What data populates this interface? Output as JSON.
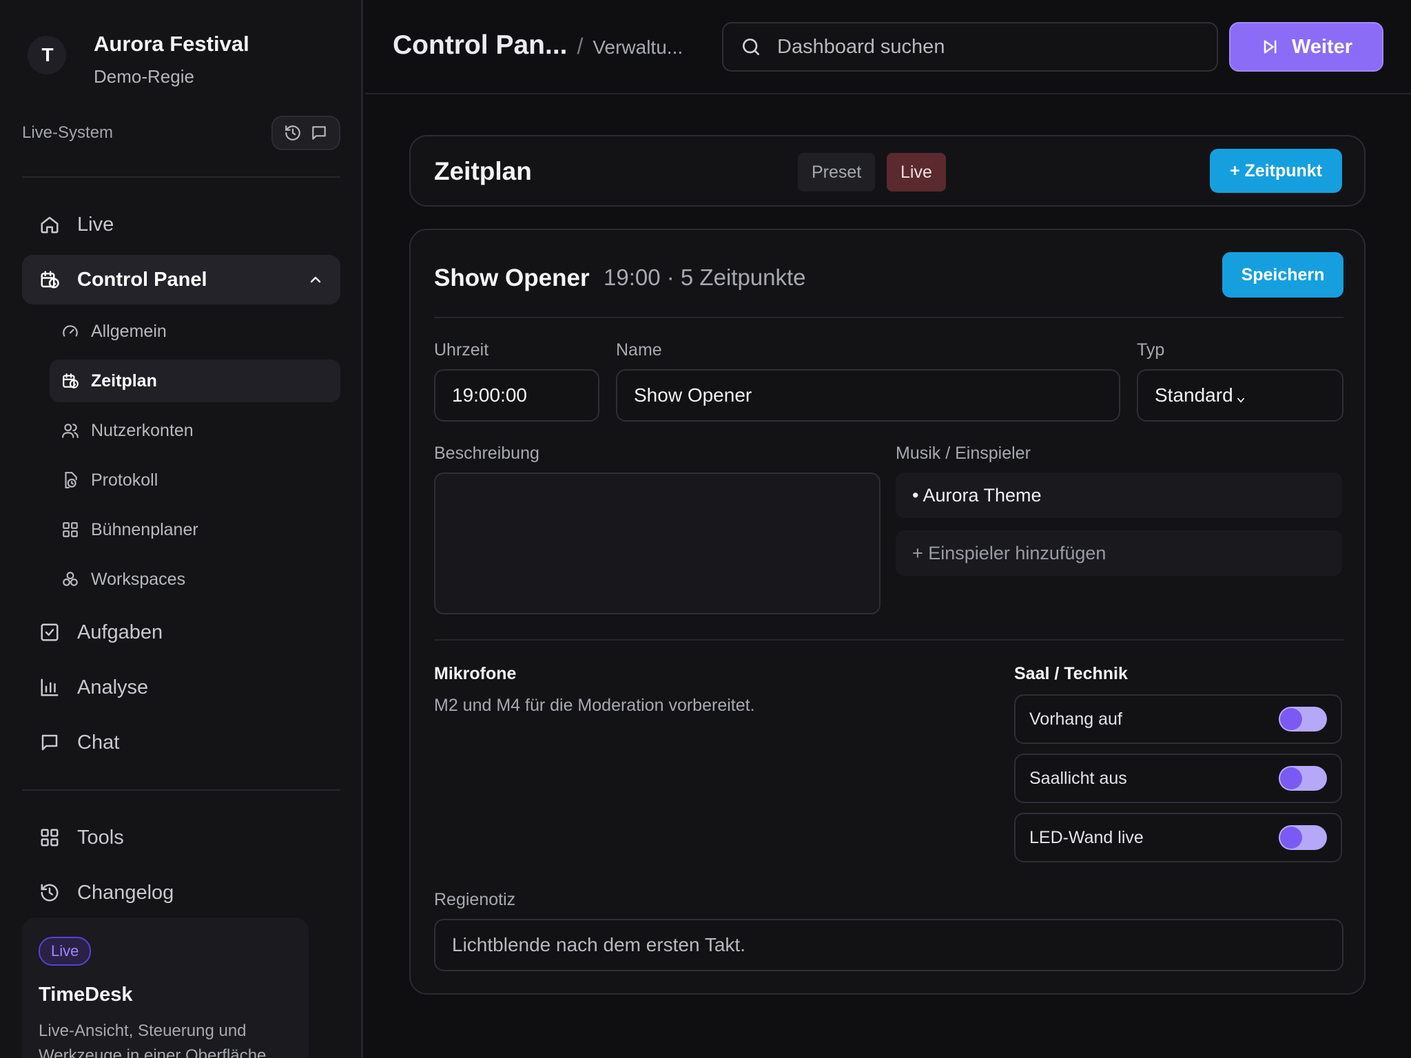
{
  "sidebar": {
    "brand": {
      "logo_text": "T",
      "title": "Aurora Festival",
      "subtitle": "Demo-Regie"
    },
    "system_label": "Live-System",
    "nav": [
      {
        "label": "Live",
        "icon": "home-icon"
      },
      {
        "label": "Control Panel",
        "icon": "calendar-clock-icon",
        "expanded": true
      }
    ],
    "subnav": [
      {
        "label": "Allgemein",
        "icon": "gauge-icon"
      },
      {
        "label": "Zeitplan",
        "icon": "calendar-clock-icon",
        "active": true
      },
      {
        "label": "Nutzerkonten",
        "icon": "users-icon"
      },
      {
        "label": "Protokoll",
        "icon": "file-clock-icon"
      },
      {
        "label": "Bühnenplaner",
        "icon": "grid-icon"
      },
      {
        "label": "Workspaces",
        "icon": "blocks-icon"
      }
    ],
    "nav2": [
      {
        "label": "Aufgaben",
        "icon": "checkbox-icon"
      },
      {
        "label": "Analyse",
        "icon": "bar-chart-icon"
      },
      {
        "label": "Chat",
        "icon": "message-icon"
      }
    ],
    "nav3": [
      {
        "label": "Tools",
        "icon": "grid-icon"
      },
      {
        "label": "Changelog",
        "icon": "history-icon"
      }
    ],
    "promo": {
      "badge": "Live",
      "title": "TimeDesk",
      "text": "Live-Ansicht, Steuerung und Werkzeuge in einer Oberfläche"
    }
  },
  "header": {
    "breadcrumb_main": "Control Pan...",
    "breadcrumb_sep": "/",
    "breadcrumb_sub": "Verwaltu...",
    "search_placeholder": "Dashboard suchen",
    "next_label": "Weiter"
  },
  "schedule": {
    "title": "Zeitplan",
    "tag_preset": "Preset",
    "tag_live": "Live",
    "add_label": "+ Zeitpunkt"
  },
  "entry": {
    "title": "Show Opener",
    "meta": "19:00 · 5 Zeitpunkte",
    "save_label": "Speichern",
    "labels": {
      "time": "Uhrzeit",
      "name": "Name",
      "type": "Typ",
      "description": "Beschreibung",
      "music": "Musik / Einspieler",
      "mics": "Mikrofone",
      "hall": "Saal / Technik",
      "note": "Regienotiz"
    },
    "time_value": "19:00:00",
    "name_value": "Show Opener",
    "type_value": "Standard",
    "description_value": "",
    "music_items": [
      "• Aurora Theme"
    ],
    "music_add": "+ Einspieler hinzufügen",
    "mics_text": "M2 und M4 für die Moderation vorbereitet.",
    "toggles": [
      {
        "label": "Vorhang auf",
        "on": true
      },
      {
        "label": "Saallicht aus",
        "on": true
      },
      {
        "label": "LED-Wand live",
        "on": true
      }
    ],
    "note_value": "Lichtblende nach dem ersten Takt."
  },
  "colors": {
    "accent_purple": "#8b6cf6",
    "accent_blue": "#169fde",
    "live_tag": "#5a2a2e"
  }
}
